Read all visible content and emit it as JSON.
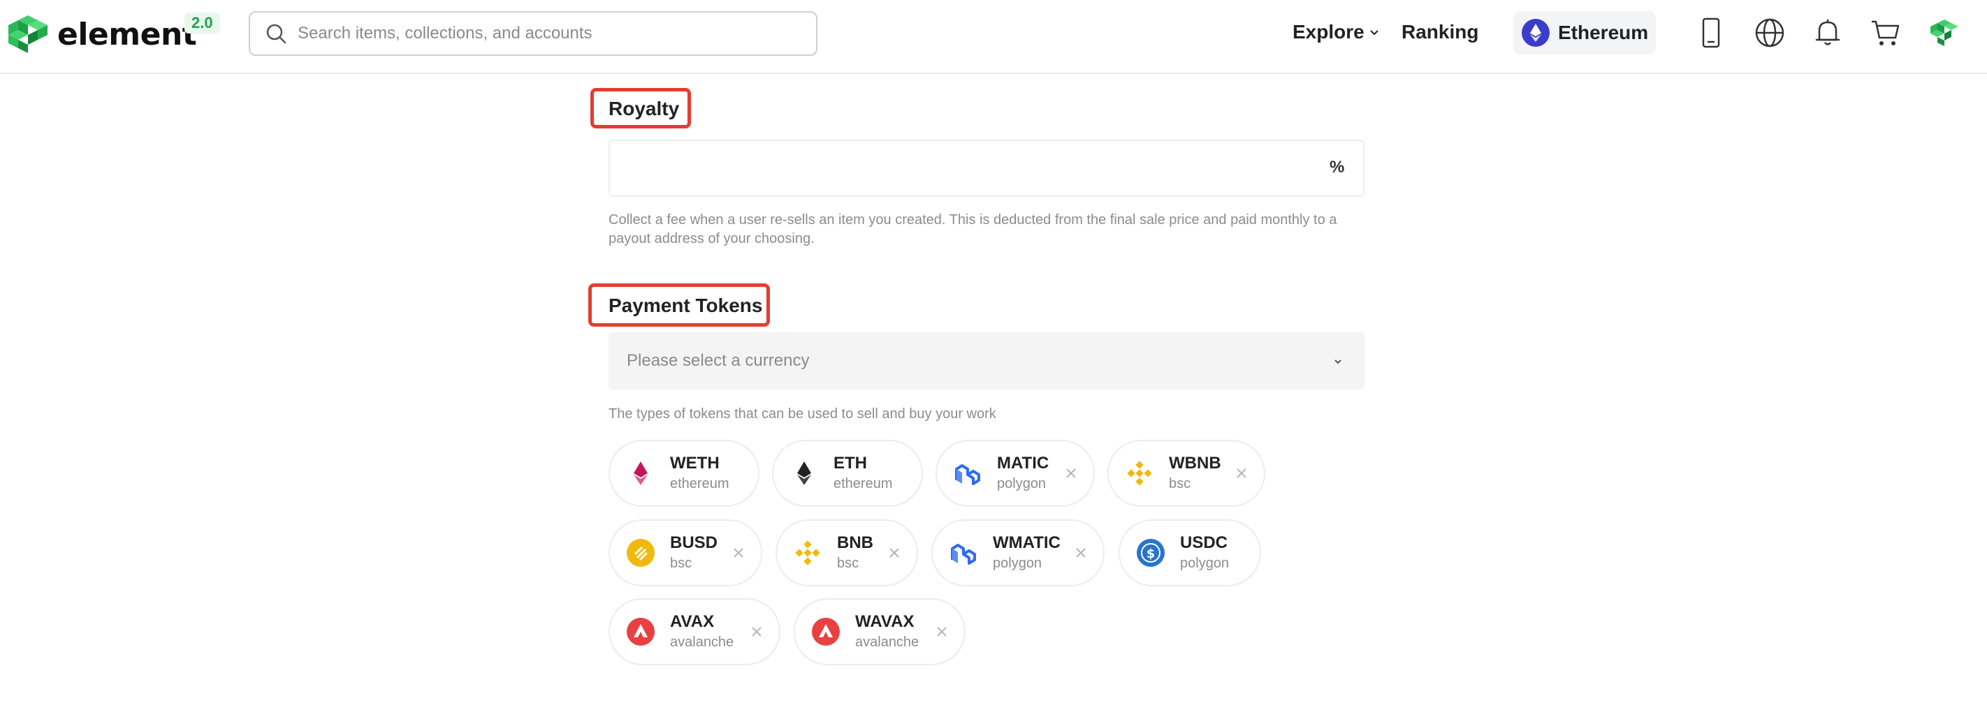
{
  "header": {
    "logo_text": "element",
    "version": "2.0",
    "search_placeholder": "Search items, collections, and accounts",
    "nav": {
      "explore": "Explore",
      "ranking": "Ranking"
    },
    "chain": "Ethereum",
    "icons": [
      "mobile-icon",
      "globe-icon",
      "bell-icon",
      "cart-icon",
      "avatar-icon"
    ]
  },
  "royalty": {
    "title": "Royalty",
    "value": "",
    "unit": "%",
    "help": "Collect a fee when a user re-sells an item you created. This is deducted from the final sale price and paid monthly to a payout address of your choosing."
  },
  "payment": {
    "title": "Payment Tokens",
    "select_placeholder": "Please select a currency",
    "help": "The types of tokens that can be used to sell and buy your work",
    "tokens": [
      {
        "symbol": "WETH",
        "network": "ethereum",
        "removable": false,
        "icon": "weth-icon",
        "color": "#c2185b"
      },
      {
        "symbol": "ETH",
        "network": "ethereum",
        "removable": false,
        "icon": "eth-icon",
        "color": "#222222"
      },
      {
        "symbol": "MATIC",
        "network": "polygon",
        "removable": true,
        "icon": "matic-icon",
        "color": "#2f6bf1"
      },
      {
        "symbol": "WBNB",
        "network": "bsc",
        "removable": true,
        "icon": "wbnb-icon",
        "color": "#f0b90b"
      },
      {
        "symbol": "BUSD",
        "network": "bsc",
        "removable": true,
        "icon": "busd-icon",
        "color": "#f0b90b"
      },
      {
        "symbol": "BNB",
        "network": "bsc",
        "removable": true,
        "icon": "bnb-icon",
        "color": "#f0b90b"
      },
      {
        "symbol": "WMATIC",
        "network": "polygon",
        "removable": true,
        "icon": "wmatic-icon",
        "color": "#2f6bf1"
      },
      {
        "symbol": "USDC",
        "network": "polygon",
        "removable": false,
        "icon": "usdc-icon",
        "color": "#2775ca"
      },
      {
        "symbol": "AVAX",
        "network": "avalanche",
        "removable": true,
        "icon": "avax-icon",
        "color": "#e84142"
      },
      {
        "symbol": "WAVAX",
        "network": "avalanche",
        "removable": true,
        "icon": "wavax-icon",
        "color": "#e84142"
      }
    ]
  },
  "colors": {
    "accent_box": "#e53d2f",
    "brand_green": "#1fa34a",
    "eth_purple": "#3c3ccc"
  }
}
